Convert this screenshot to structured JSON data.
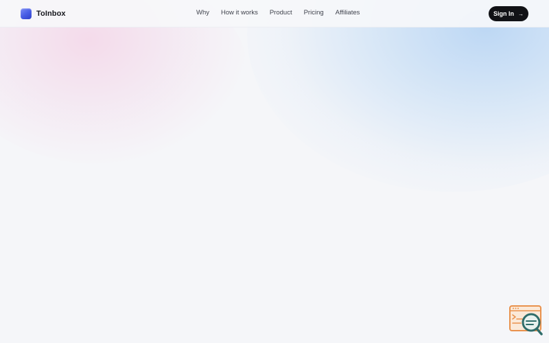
{
  "header": {
    "brand_name": "ToInbox",
    "nav": [
      {
        "label": "Why"
      },
      {
        "label": "How it works"
      },
      {
        "label": "Product"
      },
      {
        "label": "Pricing"
      },
      {
        "label": "Affiliates"
      }
    ],
    "signin_label": "Sign In",
    "signin_icon": "arrow-right-icon"
  },
  "widget": {
    "icon": "document-search-icon",
    "colors": {
      "outline": "#e9914c",
      "lens": "#2f6d6a"
    }
  },
  "colors": {
    "background": "#f5f6f9",
    "brand_logo": "#4a5fe6",
    "signin_button": "#111216",
    "glow_pink": "#f4d6e8",
    "glow_blue": "#bad6f4"
  }
}
